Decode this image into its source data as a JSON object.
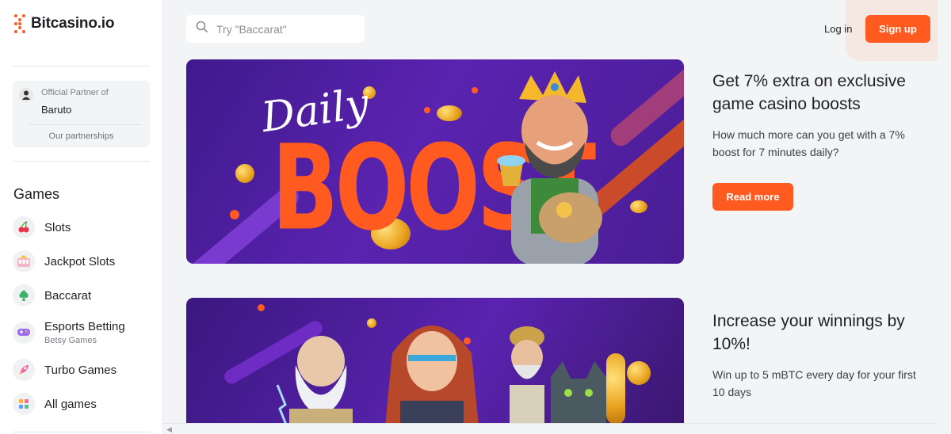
{
  "brand": {
    "name": "Bitcasino.io",
    "accent": "#ff5a1f"
  },
  "partner": {
    "small_label": "Official Partner of",
    "name": "Baruto",
    "link": "Our partnerships"
  },
  "games": {
    "title": "Games",
    "items": [
      {
        "label": "Slots",
        "icon": "cherry-icon",
        "sub": ""
      },
      {
        "label": "Jackpot Slots",
        "icon": "jackpot-icon",
        "sub": ""
      },
      {
        "label": "Baccarat",
        "icon": "spade-icon",
        "sub": ""
      },
      {
        "label": "Esports Betting",
        "icon": "gamepad-icon",
        "sub": "Betsy Games"
      },
      {
        "label": "Turbo Games",
        "icon": "rocket-icon",
        "sub": ""
      },
      {
        "label": "All games",
        "icon": "grid-icon",
        "sub": ""
      }
    ]
  },
  "header": {
    "search_placeholder": "Try \"Baccarat\"",
    "login": "Log in",
    "signup": "Sign up"
  },
  "promos": [
    {
      "banner_text_1": "Daily",
      "banner_text_2": "BOOST",
      "title": "Get 7% extra on exclusive game casino boosts",
      "description": "How much more can you get with a 7% boost for 7 minutes daily?",
      "cta": "Read more"
    },
    {
      "title": "Increase your winnings by 10%!",
      "description": "Win up to 5 mBTC every day for your first 10 days"
    }
  ]
}
